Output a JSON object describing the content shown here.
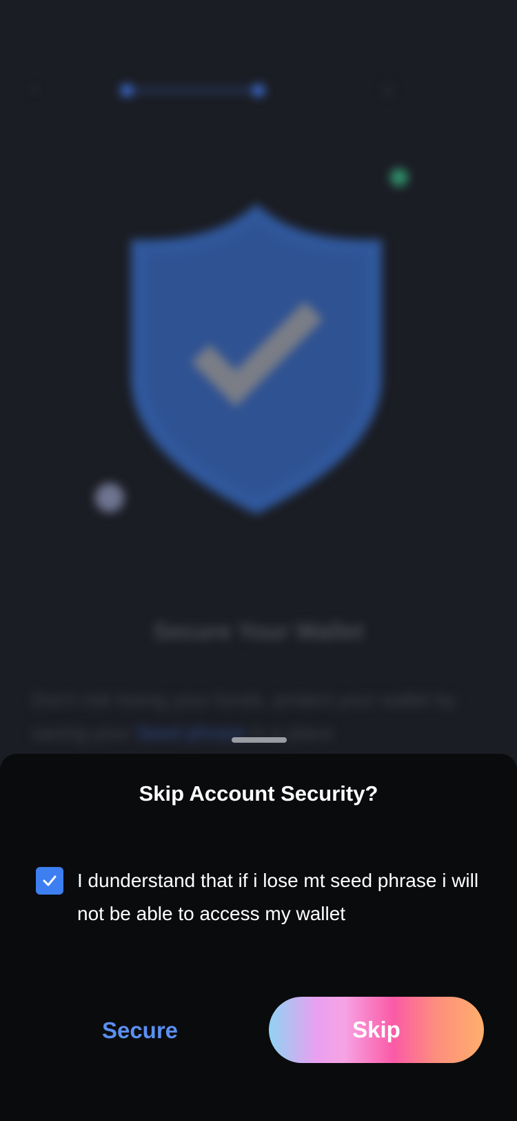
{
  "background": {
    "title": "Secure Your Wallet",
    "description_start": "Don't risk losing your funds. protect your wallet by saving your ",
    "description_link": "Seed phrase",
    "description_end": " in a place"
  },
  "sheet": {
    "title": "Skip Account Security?",
    "checkbox_checked": true,
    "checkbox_label": "I dunderstand that if i lose mt seed phrase i will not be able to access my wallet",
    "secure_label": "Secure",
    "skip_label": "Skip"
  },
  "colors": {
    "accent": "#3d7ff0",
    "secure_text": "#5b8ff0",
    "sheet_background": "#0a0b0d",
    "page_background": "#1b1d24"
  },
  "icons": {
    "back": "back-arrow-icon",
    "check": "checkmark-icon",
    "shield": "shield-check-icon"
  }
}
